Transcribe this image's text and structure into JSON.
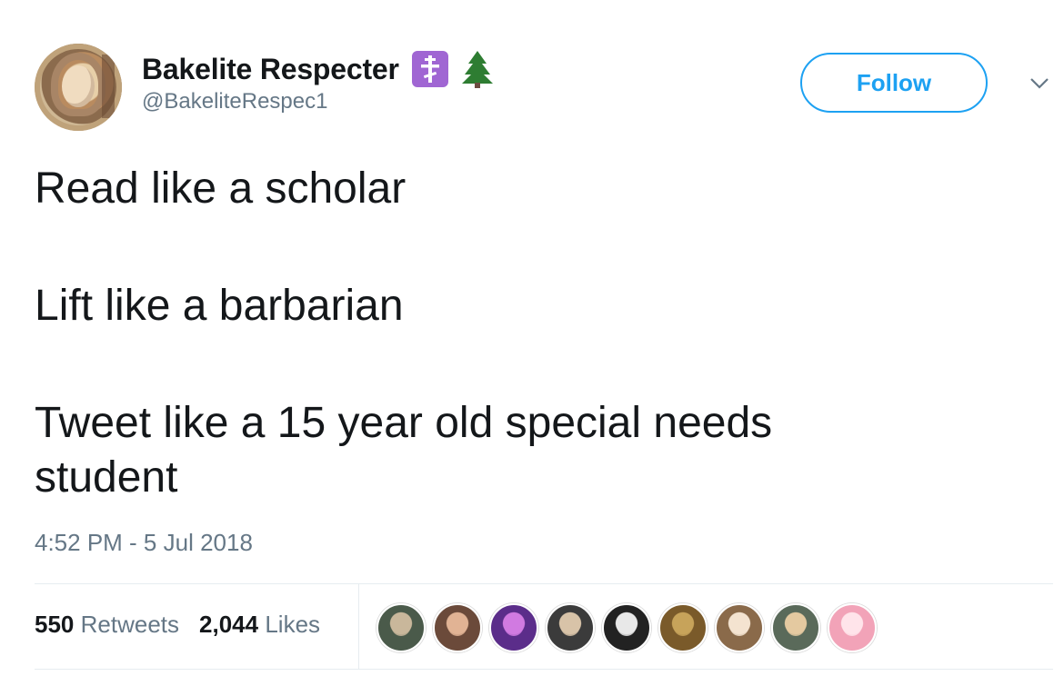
{
  "user": {
    "display_name": "Bakelite Respecter",
    "handle": "@BakeliteRespec1",
    "avatar_icon": "medieval-portrait-avatar",
    "name_emojis": [
      "orthodox-cross-icon",
      "christmas-tree-icon"
    ]
  },
  "follow_label": "Follow",
  "menu_icon": "chevron-down-icon",
  "tweet": {
    "lines": [
      "Read like a scholar",
      "Lift like a barbarian",
      "Tweet like a 15 year old special needs",
      "student"
    ],
    "timestamp": "4:52 PM - 5 Jul 2018"
  },
  "stats": {
    "retweets_count": "550",
    "retweets_label": "Retweets",
    "likes_count": "2,044",
    "likes_label": "Likes"
  },
  "likers": [
    {
      "name": "liker-avatar-1",
      "c1": "#4a5a4a",
      "c2": "#c9b79b"
    },
    {
      "name": "liker-avatar-2",
      "c1": "#6b4a3a",
      "c2": "#e0b394"
    },
    {
      "name": "liker-avatar-3",
      "c1": "#5b2d8a",
      "c2": "#d17ae0"
    },
    {
      "name": "liker-avatar-4",
      "c1": "#3b3b3b",
      "c2": "#d8c3a8"
    },
    {
      "name": "liker-avatar-5",
      "c1": "#222222",
      "c2": "#e8e8e8"
    },
    {
      "name": "liker-avatar-6",
      "c1": "#7a5a2a",
      "c2": "#c7a35a"
    },
    {
      "name": "liker-avatar-7",
      "c1": "#8a6a4a",
      "c2": "#f3e3d0"
    },
    {
      "name": "liker-avatar-8",
      "c1": "#5a6a5a",
      "c2": "#e4c9a0"
    },
    {
      "name": "liker-avatar-9",
      "c1": "#f2a3b8",
      "c2": "#ffe4ea"
    }
  ],
  "colors": {
    "accent": "#1da1f2",
    "text": "#14171a",
    "muted": "#657786",
    "badge": "#a066d3"
  }
}
